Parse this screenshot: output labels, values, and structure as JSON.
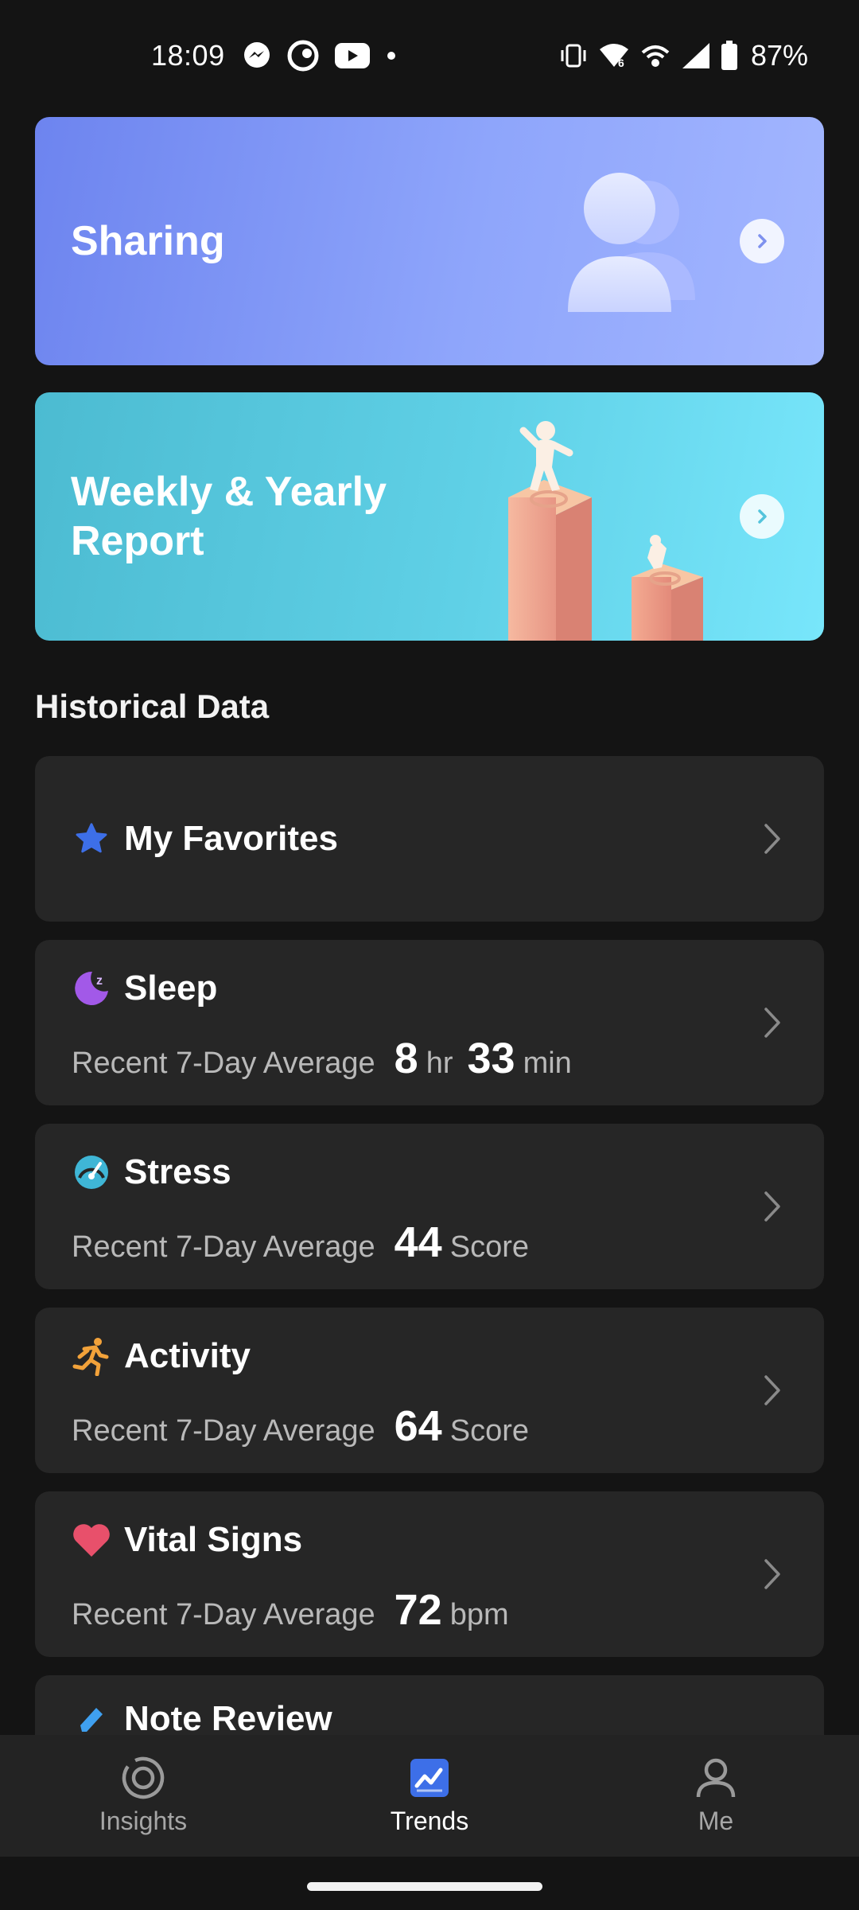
{
  "status_bar": {
    "time": "18:09",
    "battery": "87%",
    "left_icons": [
      "messenger-icon",
      "crunchyroll-icon",
      "youtube-icon",
      "dot-icon"
    ],
    "right_icons": [
      "vibrate-icon",
      "wifi-6-icon",
      "hotspot-icon",
      "signal-icon",
      "battery-icon"
    ]
  },
  "banners": {
    "sharing": {
      "title": "Sharing"
    },
    "report": {
      "title": "Weekly & Yearly Report"
    }
  },
  "historical": {
    "title": "Historical Data",
    "favorites": {
      "title": "My Favorites"
    },
    "sleep": {
      "title": "Sleep",
      "label": "Recent 7-Day Average",
      "value1": "8",
      "unit1": "hr",
      "value2": "33",
      "unit2": "min"
    },
    "stress": {
      "title": "Stress",
      "label": "Recent 7-Day Average",
      "value": "44",
      "unit": "Score"
    },
    "activity": {
      "title": "Activity",
      "label": "Recent 7-Day Average",
      "value": "64",
      "unit": "Score"
    },
    "vital": {
      "title": "Vital Signs",
      "label": "Recent 7-Day Average",
      "value": "72",
      "unit": "bpm"
    },
    "note": {
      "title": "Note Review"
    }
  },
  "nav": {
    "insights": "Insights",
    "trends": "Trends",
    "me": "Me",
    "active": "Trends"
  },
  "colors": {
    "background": "#141414",
    "card": "#262626",
    "accent_blue": "#3d6fe8",
    "sleep_purple": "#a259e8",
    "stress_teal": "#3fb6d6",
    "activity_orange": "#f2a23a",
    "vital_red": "#e8506b"
  }
}
